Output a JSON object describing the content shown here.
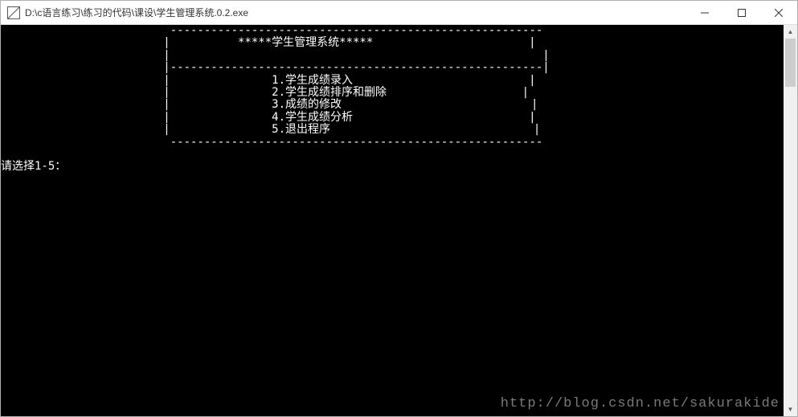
{
  "titlebar": {
    "title": "D:\\c语言练习\\练习的代码\\课设\\学生管理系统.0.2.exe"
  },
  "console": {
    "border_top": "                         -------------------------------------------------------",
    "title_line": "                        |          *****学生管理系统*****                       |",
    "blank_side": "                        |                                                       |",
    "sep_line": "                        |-------------------------------------------------------|",
    "menu_1": "                        |               1.学生成绩录入                          |",
    "menu_2": "                        |               2.学生成绩排序和删除                    |",
    "menu_3": "                        |               3.成绩的修改                            |",
    "menu_4": "                        |               4.学生成绩分析                          |",
    "menu_5": "                        |               5.退出程序                              |",
    "border_bottom": "                         -------------------------------------------------------",
    "prompt": "请选择1-5："
  },
  "watermark": "http://blog.csdn.net/sakurakide"
}
